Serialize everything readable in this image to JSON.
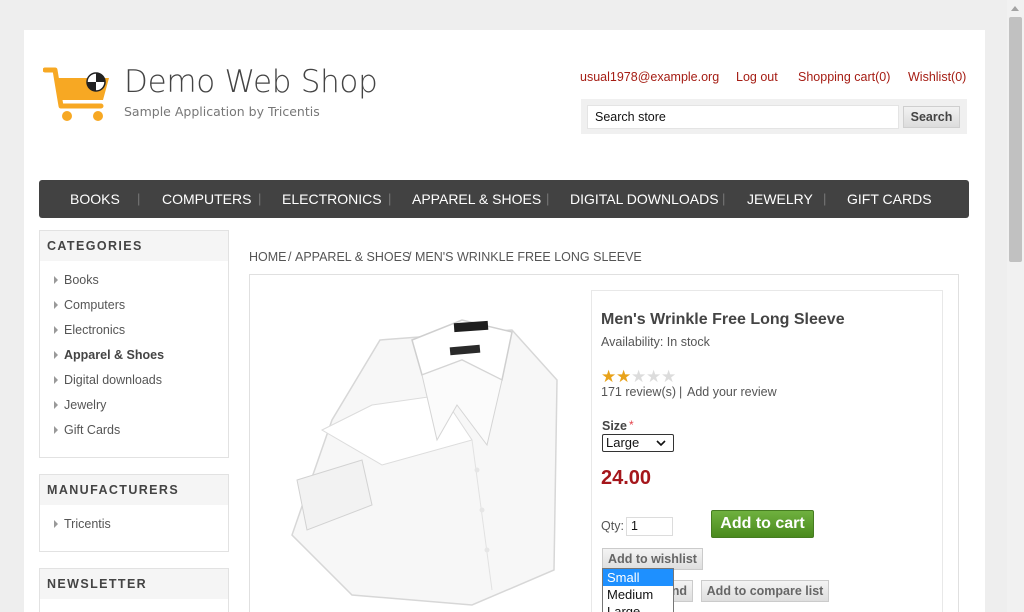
{
  "header": {
    "logo_title": "Demo Web Shop",
    "logo_subtitle": "Sample Application by Tricentis",
    "account_email": "usual1978@example.org",
    "logout": "Log out",
    "shopping_cart": "Shopping cart(0)",
    "wishlist": "Wishlist(0)",
    "search_value": "Search store",
    "search_button": "Search"
  },
  "menu": [
    "BOOKS",
    "COMPUTERS",
    "ELECTRONICS",
    "APPAREL & SHOES",
    "DIGITAL DOWNLOADS",
    "JEWELRY",
    "GIFT CARDS"
  ],
  "menu_separator": "|",
  "sidebar": {
    "categories_title": "CATEGORIES",
    "categories": [
      "Books",
      "Computers",
      "Electronics",
      "Apparel & Shoes",
      "Digital downloads",
      "Jewelry",
      "Gift Cards"
    ],
    "active_category": "Apparel & Shoes",
    "manufacturers_title": "MANUFACTURERS",
    "manufacturers": [
      "Tricentis"
    ],
    "newsletter_title": "NEWSLETTER"
  },
  "breadcrumb": [
    "HOME",
    "APPAREL & SHOES",
    "MEN'S WRINKLE FREE LONG SLEEVE"
  ],
  "breadcrumb_separator": "/",
  "product": {
    "name": "Men's Wrinkle Free Long Sleeve",
    "availability_label": "Availability:",
    "availability_value": "In stock",
    "rating": 2,
    "rating_max": 5,
    "star_glyph": "★",
    "reviews": "171 review(s)",
    "review_separator": "|",
    "add_review": "Add your review",
    "size_label": "Size",
    "required_mark": "*",
    "size_selected": "Large",
    "size_options": [
      "Small",
      "Medium",
      "Large"
    ],
    "highlighted_option": "Small",
    "price": "24.00",
    "qty_label": "Qty:",
    "qty_value": "1",
    "add_to_cart": "Add to cart",
    "add_to_wishlist": "Add to wishlist",
    "email_friend_partial": "nd",
    "add_to_compare": "Add to compare list"
  },
  "colors": {
    "link_red": "#a51d14",
    "menu_bg": "#424242",
    "cart_green": "#5a9e2c",
    "price_red": "#a5161b",
    "logo_orange": "#f7a823",
    "star_gold": "#e8a21a",
    "dropdown_highlight": "#1e90ff"
  },
  "icons": [
    "cart-logo-icon",
    "caret-right-icon",
    "star-icon",
    "chevron-down-icon"
  ]
}
